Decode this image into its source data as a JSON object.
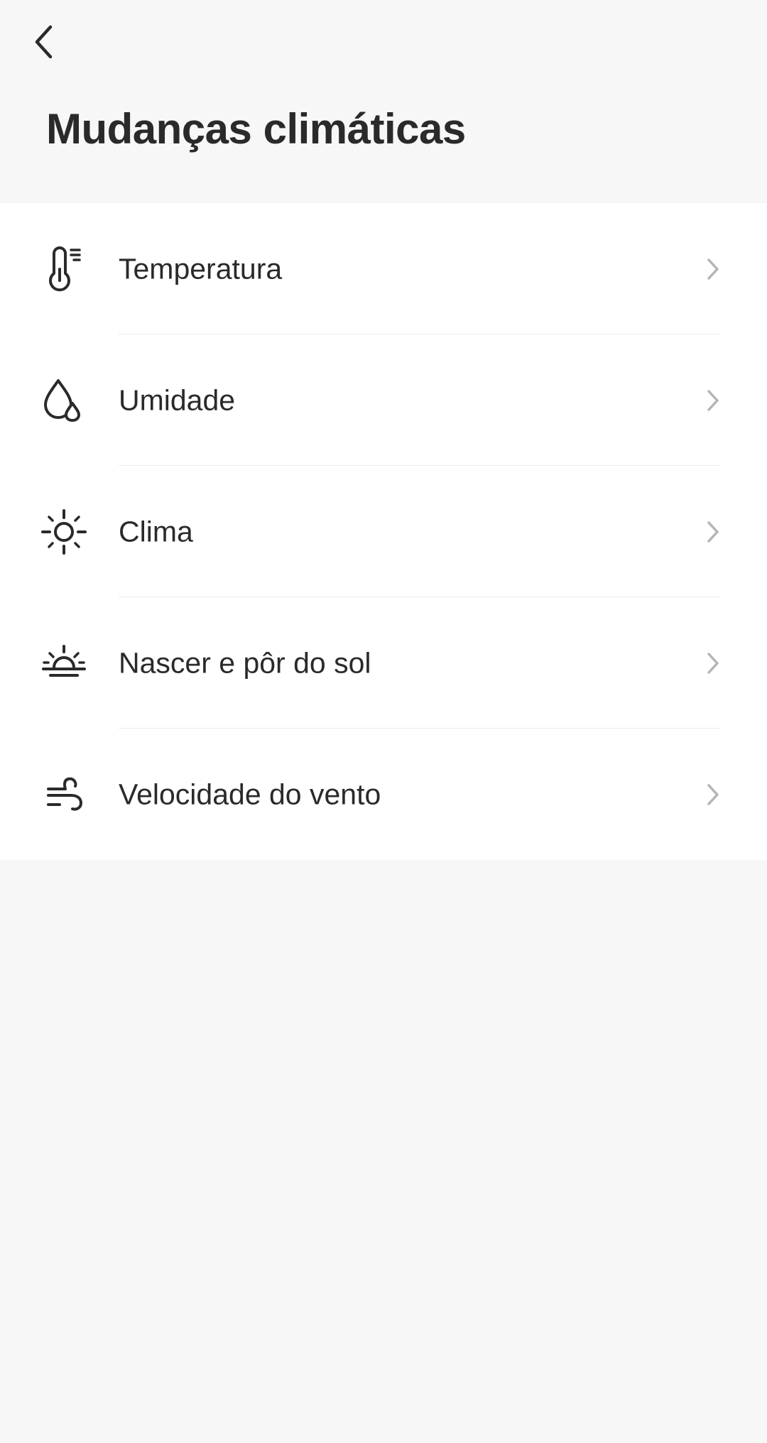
{
  "header": {
    "title": "Mudanças climáticas",
    "back_icon": "chevron-left-icon"
  },
  "list": {
    "items": [
      {
        "label": "Temperatura",
        "icon": "thermometer-icon"
      },
      {
        "label": "Umidade",
        "icon": "humidity-drop-icon"
      },
      {
        "label": "Clima",
        "icon": "sun-icon"
      },
      {
        "label": "Nascer e pôr do sol",
        "icon": "sunrise-sunset-icon"
      },
      {
        "label": "Velocidade do vento",
        "icon": "wind-icon"
      }
    ],
    "chevron_icon": "chevron-right-icon"
  },
  "colors": {
    "background": "#f7f7f7",
    "list_background": "#ffffff",
    "text": "#2a2a2a",
    "chevron": "#b5b5b5",
    "divider": "#ececec"
  }
}
